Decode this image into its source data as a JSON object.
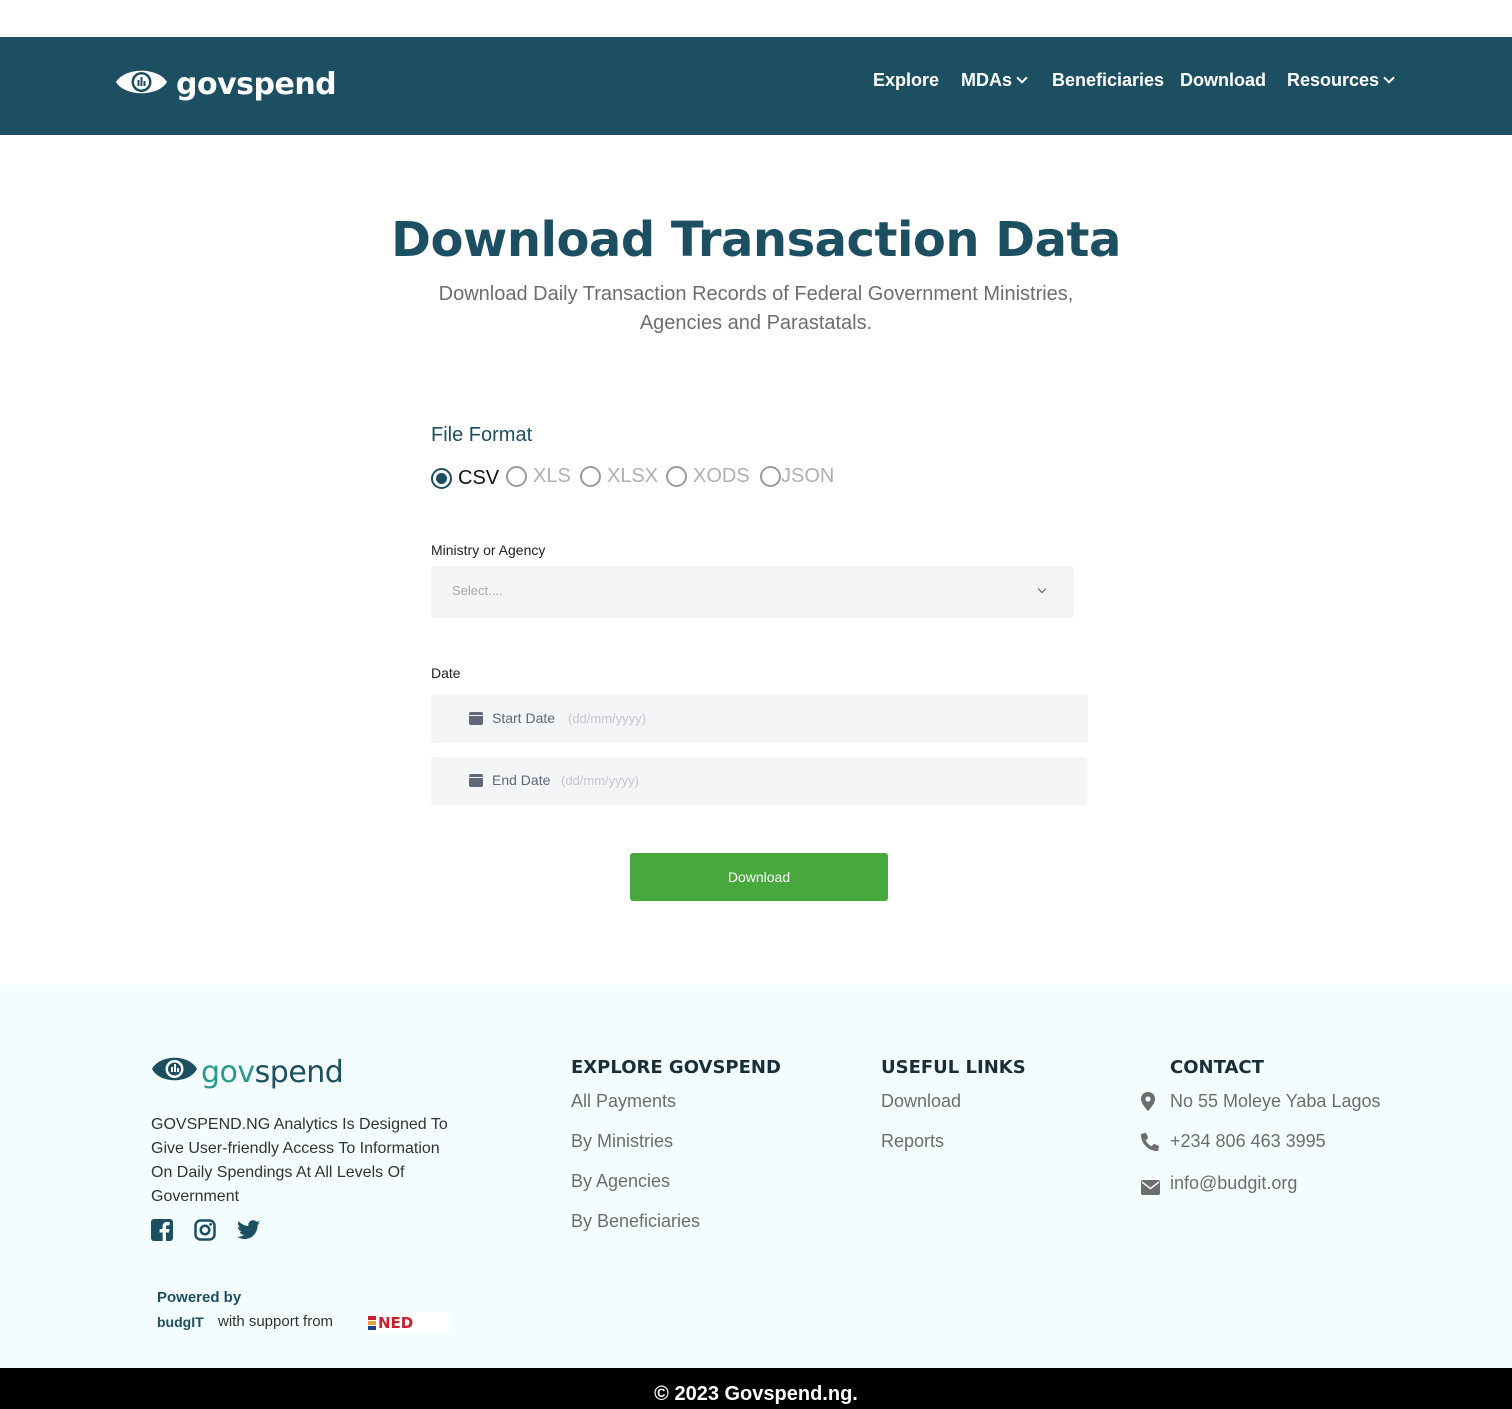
{
  "header": {
    "brand": "govspend",
    "nav": [
      {
        "label": "Explore",
        "dropdown": false
      },
      {
        "label": "MDAs",
        "dropdown": true
      },
      {
        "label": "Beneficiaries",
        "dropdown": false
      },
      {
        "label": "Download",
        "dropdown": false
      },
      {
        "label": "Resources",
        "dropdown": true
      }
    ]
  },
  "hero": {
    "title": "Download Transaction Data",
    "subtitle": "Download Daily Transaction Records of Federal Government Ministries, Agencies and Parastatals."
  },
  "form": {
    "file_format_label": "File Format",
    "formats": [
      "CSV",
      "XLS",
      "XLSX",
      "XODS",
      "JSON"
    ],
    "selected_format": "CSV",
    "ministry_label": "Ministry or Agency",
    "ministry_placeholder": "Select....",
    "date_label": "Date",
    "start_date_label": "Start Date",
    "start_date_hint": "(dd/mm/yyyy)",
    "end_date_label": "End Date",
    "end_date_hint": "(dd/mm/yyyy)",
    "download_button": "Download"
  },
  "footer": {
    "brand_gov": "gov",
    "brand_spend": "spend",
    "description": "GOVSPEND.NG Analytics Is Designed To Give User-friendly Access To Information On Daily Spendings At All Levels Of Government",
    "socials": [
      "facebook-icon",
      "instagram-icon",
      "twitter-icon"
    ],
    "powered_by": "Powered by",
    "budgit_logo": "budgIT",
    "with_support": "with support from",
    "ned_logo": "NED",
    "explore_title": "EXPLORE GOVSPEND",
    "explore_links": [
      "All Payments",
      "By Ministries",
      "By Agencies",
      "By Beneficiaries"
    ],
    "useful_title": "USEFUL LINKS",
    "useful_links": [
      "Download",
      "Reports"
    ],
    "contact_title": "CONTACT",
    "address": "No 55 Moleye Yaba Lagos",
    "phone": "+234 806 463 3995",
    "email": "info@budgit.org"
  },
  "copyright": "© 2023 Govspend.ng.",
  "colors": {
    "header_bg": "#1d4f63",
    "primary": "#1d4f63",
    "button_green": "#47a83b",
    "footer_bg": "#f4fdfd",
    "teal_accent": "#2a9a8e"
  }
}
